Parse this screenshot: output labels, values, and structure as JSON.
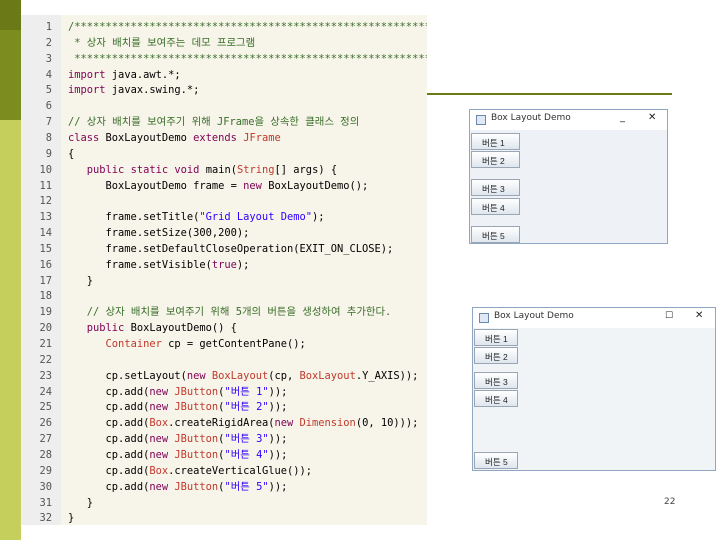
{
  "code": {
    "lines": [
      {
        "n": "1",
        "text": "/**********************************************************"
      },
      {
        "n": "2",
        "text": " * 상자 배치를 보여주는 데모 프로그램"
      },
      {
        "n": "3",
        "text": " **********************************************************/"
      },
      {
        "n": "4",
        "text": "import java.awt.*;"
      },
      {
        "n": "5",
        "text": "import javax.swing.*;"
      },
      {
        "n": "6",
        "text": ""
      },
      {
        "n": "7",
        "text": "// 상자 배치를 보여주기 위해 JFrame을 상속한 클래스 정의"
      },
      {
        "n": "8",
        "text": "class BoxLayoutDemo extends JFrame"
      },
      {
        "n": "9",
        "text": "{"
      },
      {
        "n": "10",
        "text": "   public static void main(String[] args) {"
      },
      {
        "n": "11",
        "text": "      BoxLayoutDemo frame = new BoxLayoutDemo();"
      },
      {
        "n": "12",
        "text": ""
      },
      {
        "n": "13",
        "text": "      frame.setTitle(\"Grid Layout Demo\");"
      },
      {
        "n": "14",
        "text": "      frame.setSize(300,200);"
      },
      {
        "n": "15",
        "text": "      frame.setDefaultCloseOperation(EXIT_ON_CLOSE);"
      },
      {
        "n": "16",
        "text": "      frame.setVisible(true);"
      },
      {
        "n": "17",
        "text": "   }"
      },
      {
        "n": "18",
        "text": ""
      },
      {
        "n": "19",
        "text": "   // 상자 배치를 보여주기 위해 5개의 버튼을 생성하여 추가한다."
      },
      {
        "n": "20",
        "text": "   public BoxLayoutDemo() {"
      },
      {
        "n": "21",
        "text": "      Container cp = getContentPane();"
      },
      {
        "n": "22",
        "text": ""
      },
      {
        "n": "23",
        "text": "      cp.setLayout(new BoxLayout(cp, BoxLayout.Y_AXIS));"
      },
      {
        "n": "24",
        "text": "      cp.add(new JButton(\"버튼 1\"));"
      },
      {
        "n": "25",
        "text": "      cp.add(new JButton(\"버튼 2\"));"
      },
      {
        "n": "26",
        "text": "      cp.add(Box.createRigidArea(new Dimension(0, 10)));"
      },
      {
        "n": "27",
        "text": "      cp.add(new JButton(\"버튼 3\"));"
      },
      {
        "n": "28",
        "text": "      cp.add(new JButton(\"버튼 4\"));"
      },
      {
        "n": "29",
        "text": "      cp.add(Box.createVerticalGlue());"
      },
      {
        "n": "30",
        "text": "      cp.add(new JButton(\"버튼 5\"));"
      },
      {
        "n": "31",
        "text": "   }"
      },
      {
        "n": "32",
        "text": "}"
      }
    ]
  },
  "window1": {
    "title": "Box Layout Demo",
    "minimize_icon": "minimize-icon",
    "close_icon": "close-icon",
    "buttons": [
      "버튼 1",
      "버튼 2",
      "버튼 3",
      "버튼 4",
      "버튼 5"
    ]
  },
  "window2": {
    "title": "Box Layout Demo",
    "maximize_icon": "maximize-icon",
    "close_icon": "close-icon",
    "buttons": [
      "버튼 1",
      "버튼 2",
      "버튼 3",
      "버튼 4",
      "버튼 5"
    ]
  },
  "page_number": "22",
  "colors": {
    "keyword": "#7f0055",
    "type": "#c0392b",
    "string": "#2a00ff",
    "comment": "#3a6e2a",
    "accent": "#6b7a16"
  }
}
